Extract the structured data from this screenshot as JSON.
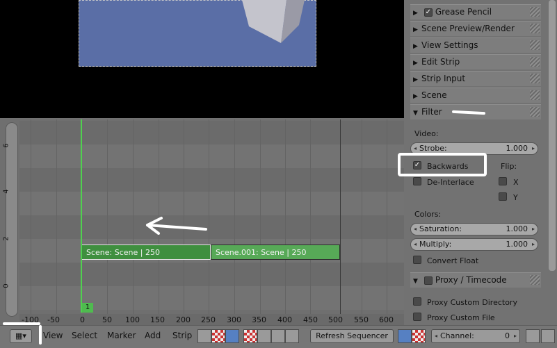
{
  "timeline": {
    "y_ticks": [
      "0",
      "2",
      "4",
      "6"
    ],
    "x_ticks": [
      "-100",
      "-50",
      "0",
      "50",
      "100",
      "150",
      "200",
      "250",
      "300",
      "350",
      "400",
      "450",
      "500",
      "550",
      "600"
    ],
    "current_frame": "1",
    "strips": [
      {
        "label": "Scene: Scene | 250"
      },
      {
        "label": "Scene.001: Scene | 250"
      }
    ]
  },
  "header": {
    "menus": [
      "View",
      "Select",
      "Marker",
      "Add",
      "Strip"
    ],
    "refresh_label": "Refresh Sequencer",
    "channel_label": "Channel:",
    "channel_value": "0"
  },
  "panel": {
    "sections": [
      {
        "label": "Grease Pencil",
        "expanded": false,
        "checkbox": true
      },
      {
        "label": "Scene Preview/Render",
        "expanded": false
      },
      {
        "label": "View Settings",
        "expanded": false
      },
      {
        "label": "Edit Strip",
        "expanded": false
      },
      {
        "label": "Strip Input",
        "expanded": false
      },
      {
        "label": "Scene",
        "expanded": false
      },
      {
        "label": "Filter",
        "expanded": true
      }
    ],
    "filter": {
      "video_label": "Video:",
      "strobe_label": "Strobe:",
      "strobe_value": "1.000",
      "backwards_label": "Backwards",
      "backwards_checked": true,
      "flip_label": "Flip:",
      "flip_x_label": "X",
      "flip_y_label": "Y",
      "deinterlace_label": "De-Interlace",
      "colors_label": "Colors:",
      "saturation_label": "Saturation:",
      "saturation_value": "1.000",
      "multiply_label": "Multiply:",
      "multiply_value": "1.000",
      "convert_float_label": "Convert Float"
    },
    "proxy": {
      "label": "Proxy / Timecode",
      "custom_directory_label": "Proxy Custom Directory",
      "custom_file_label": "Proxy Custom File"
    }
  },
  "colors": {
    "strip_green": "#3f8f3f",
    "playhead_green": "#4fd14f",
    "active_blue": "#5680c2"
  }
}
